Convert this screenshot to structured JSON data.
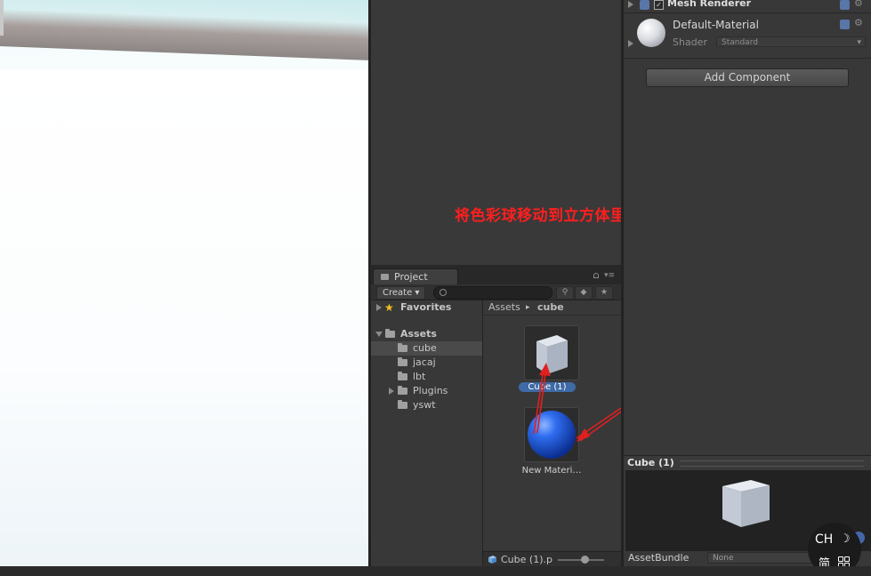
{
  "annotation": "将色彩球移动到立方体里",
  "project": {
    "tab_label": "Project",
    "create_label": "Create ▾",
    "search_placeholder": "",
    "tree": {
      "favorites": "Favorites",
      "assets": "Assets",
      "folders": [
        {
          "label": "cube",
          "selected": true
        },
        {
          "label": "jacaj",
          "selected": false
        },
        {
          "label": "lbt",
          "selected": false
        },
        {
          "label": "Plugins",
          "selected": false
        },
        {
          "label": "yswt",
          "selected": false
        }
      ]
    },
    "breadcrumb": {
      "root": "Assets",
      "separator": "▸",
      "current": "cube"
    },
    "assets": [
      {
        "label": "Cube (1)",
        "selected": true,
        "icon": "cube-prefab-icon"
      },
      {
        "label": "New Materi…",
        "selected": false,
        "icon": "material-sphere-icon"
      }
    ],
    "footer_file": "Cube (1).p"
  },
  "inspector": {
    "component_title": "Mesh Renderer",
    "material_name": "Default-Material",
    "shader_label": "Shader",
    "shader_value": "Standard",
    "add_component": "Add Component"
  },
  "preview": {
    "title": "Cube (1)",
    "assetbundle_label": "AssetBundle",
    "assetbundle_value": "None"
  },
  "ime": {
    "lang": "CH",
    "mode": "简"
  },
  "colors": {
    "annotation": "#ff1e1e",
    "selection": "#3e6aa6",
    "arrow": "#e02020"
  }
}
